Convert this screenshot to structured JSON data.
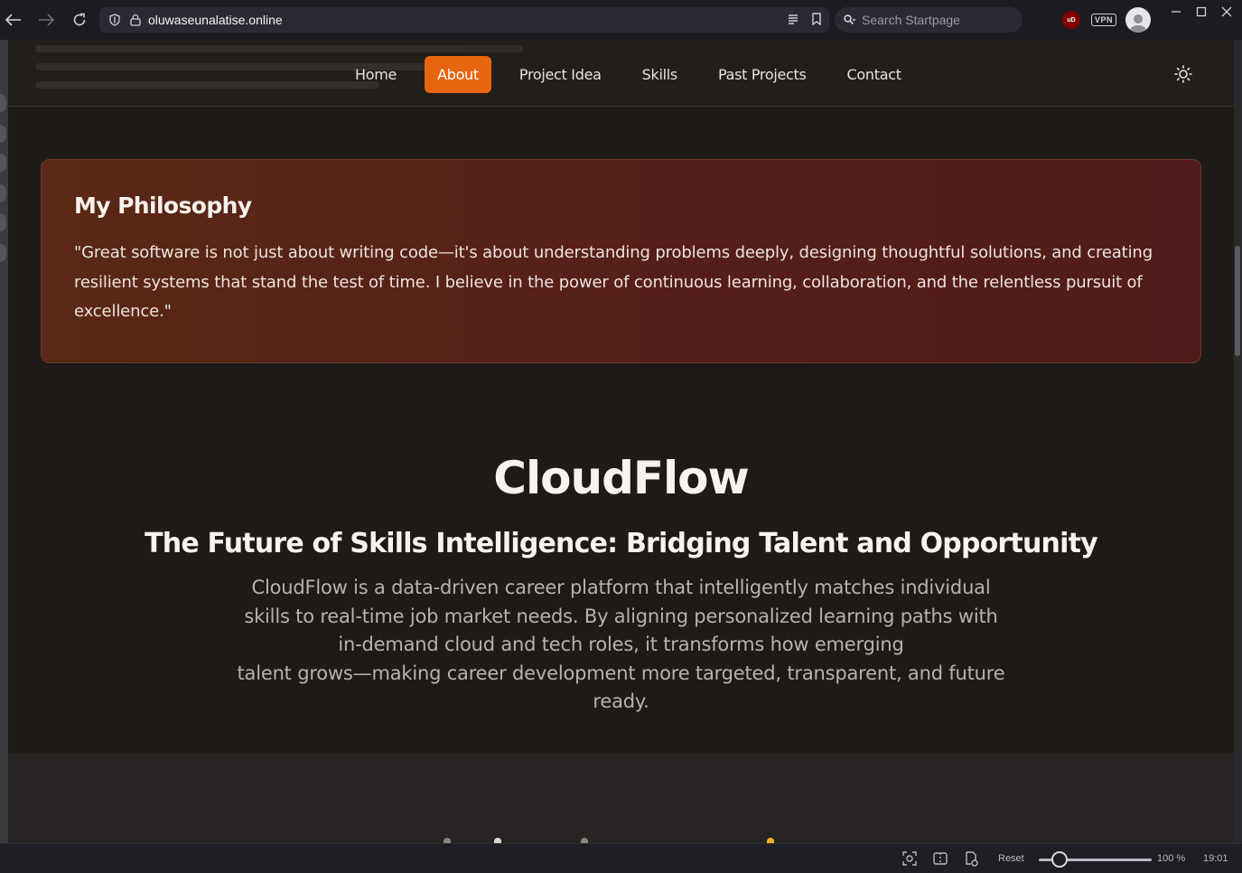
{
  "browser": {
    "url": "oluwaseunalatise.online",
    "search_placeholder": "Search Startpage",
    "ublock_label": "uD",
    "vpn_label": "VPN"
  },
  "site_nav": {
    "items": [
      {
        "label": "Home",
        "active": false
      },
      {
        "label": "About",
        "active": true
      },
      {
        "label": "Project Idea",
        "active": false
      },
      {
        "label": "Skills",
        "active": false
      },
      {
        "label": "Past Projects",
        "active": false
      },
      {
        "label": "Contact",
        "active": false
      }
    ],
    "accent_color": "#e8650f"
  },
  "philosophy": {
    "title": "My Philosophy",
    "quote": "\"Great software is not just about writing code—it's about understanding problems deeply, designing thoughtful solutions, and creating resilient systems that stand the test of time. I believe in the power of continuous learning, collaboration, and the relentless pursuit of excellence.\""
  },
  "hero": {
    "title": "CloudFlow",
    "subtitle": "The Future of Skills Intelligence: Bridging Talent and Opportunity",
    "description_lines": [
      "CloudFlow is a data-driven career platform that intelligently matches individual",
      "skills to real-time job market needs. By aligning personalized learning paths with",
      "in-demand cloud and tech roles, it transforms how emerging",
      "talent grows—making career development more targeted, transparent, and future",
      "ready."
    ]
  },
  "status_bar": {
    "reset_label": "Reset",
    "zoom": "100 %",
    "time": "19:01"
  }
}
